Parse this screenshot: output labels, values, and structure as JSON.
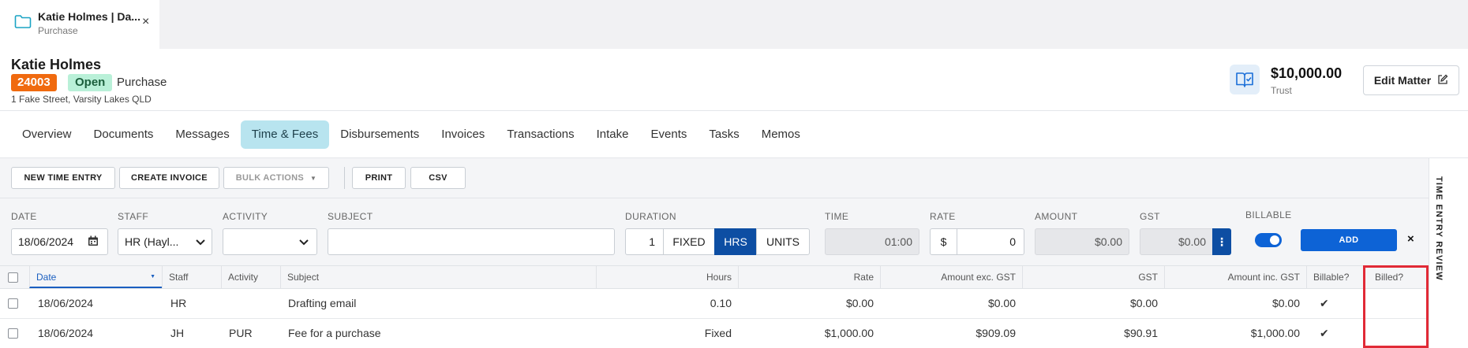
{
  "tab": {
    "title": "Katie Holmes | Da...",
    "subtitle": "Purchase",
    "close": "×"
  },
  "matter": {
    "client_name": "Katie Holmes",
    "number": "24003",
    "status": "Open",
    "type": "Purchase",
    "address": "1 Fake Street, Varsity Lakes QLD",
    "trust_amount": "$10,000.00",
    "trust_label": "Trust",
    "edit_label": "Edit Matter"
  },
  "nav": {
    "items": [
      "Overview",
      "Documents",
      "Messages",
      "Time & Fees",
      "Disbursements",
      "Invoices",
      "Transactions",
      "Intake",
      "Events",
      "Tasks",
      "Memos"
    ],
    "active": "Time & Fees"
  },
  "toolbar": {
    "new_time_entry": "NEW TIME ENTRY",
    "create_invoice": "CREATE INVOICE",
    "bulk_actions": "BULK ACTIONS",
    "print": "PRINT",
    "csv": "CSV"
  },
  "form": {
    "labels": {
      "date": "DATE",
      "staff": "STAFF",
      "activity": "ACTIVITY",
      "subject": "SUBJECT",
      "duration": "DURATION",
      "time": "TIME",
      "rate": "RATE",
      "amount": "AMOUNT",
      "gst": "GST",
      "billable": "BILLABLE"
    },
    "date_value": "18/06/2024",
    "staff_value": "HR (Hayl...",
    "activity_value": "",
    "subject_value": "",
    "duration_value": "1",
    "duration_modes": [
      "FIXED",
      "HRS",
      "UNITS"
    ],
    "duration_active": "HRS",
    "time_value": "01:00",
    "rate_prefix": "$",
    "rate_value": "0",
    "amount_value": "$0.00",
    "gst_value": "$0.00",
    "billable": true,
    "add_label": "ADD",
    "close": "×"
  },
  "side_panel": {
    "label": "TIME ENTRY REVIEW"
  },
  "table": {
    "headers": {
      "date": "Date",
      "staff": "Staff",
      "activity": "Activity",
      "subject": "Subject",
      "hours": "Hours",
      "rate": "Rate",
      "amount_ex": "Amount exc. GST",
      "gst": "GST",
      "amount_inc": "Amount inc. GST",
      "billable": "Billable?",
      "billed": "Billed?"
    },
    "rows": [
      {
        "date": "18/06/2024",
        "staff": "HR",
        "activity": "",
        "subject": "Drafting email",
        "hours": "0.10",
        "rate": "$0.00",
        "amount_ex": "$0.00",
        "gst": "$0.00",
        "amount_inc": "$0.00",
        "billable": "✔",
        "billed": ""
      },
      {
        "date": "18/06/2024",
        "staff": "JH",
        "activity": "PUR",
        "subject": "Fee for a purchase",
        "hours": "Fixed",
        "rate": "$1,000.00",
        "amount_ex": "$909.09",
        "gst": "$90.91",
        "amount_inc": "$1,000.00",
        "billable": "✔",
        "billed": ""
      }
    ]
  },
  "colors": {
    "accent": "#0d63d6",
    "active_tab": "#b8e4ef",
    "matter_number": "#f06a0f",
    "status_open": "#b9f0d8",
    "highlight": "#e12a36"
  }
}
